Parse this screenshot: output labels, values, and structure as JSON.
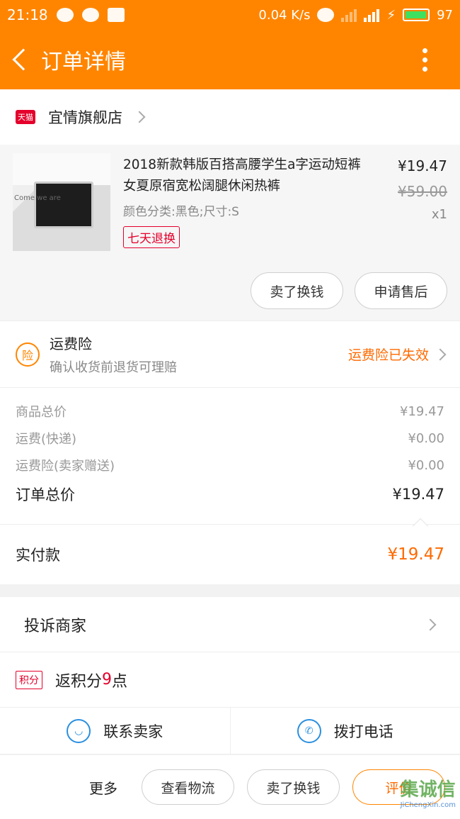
{
  "status": {
    "time": "21:18",
    "speed": "0.04 K/s",
    "battery": "97"
  },
  "header": {
    "title": "订单详情"
  },
  "store": {
    "badge": "天猫",
    "name": "宜情旗舰店"
  },
  "product": {
    "title": "2018新款韩版百搭高腰学生a字运动短裤女夏原宿宽松阔腿休闲热裤",
    "sku": "颜色分类:黑色;尺寸:S",
    "badge": "七天退换",
    "price": "¥19.47",
    "original_price": "¥59.00",
    "qty": "x1",
    "image_text": "Come we are"
  },
  "product_actions": {
    "sell_label": "卖了换钱",
    "aftersale_label": "申请售后"
  },
  "insurance": {
    "icon": "险",
    "title": "运费险",
    "subtitle": "确认收货前退货可理赔",
    "status": "运费险已失效"
  },
  "totals": {
    "rows": [
      {
        "label": "商品总价",
        "value": "¥19.47"
      },
      {
        "label": "运费(快递)",
        "value": "¥0.00"
      },
      {
        "label": "运费险(卖家赠送)",
        "value": "¥0.00"
      }
    ],
    "order_total_label": "订单总价",
    "order_total": "¥19.47",
    "paid_label": "实付款",
    "paid": "¥19.47"
  },
  "complain": {
    "label": "投诉商家"
  },
  "points": {
    "badge": "积分",
    "prefix": "返积分",
    "count": "9",
    "suffix": "点"
  },
  "contact": {
    "seller_label": "联系卖家",
    "seller_icon": "chat-bubble-icon",
    "phone_label": "拨打电话",
    "phone_icon": "phone-icon"
  },
  "bottom": {
    "more_label": "更多",
    "logistics_label": "查看物流",
    "sell_label": "卖了换钱",
    "review_label": "评价"
  },
  "watermark": {
    "text": "集诚信",
    "sub": "JiChengXin.com"
  },
  "colors": {
    "accent": "#ff8500",
    "price": "#ff6a00",
    "tmall": "#e4002b",
    "link_blue": "#2a8fe0"
  }
}
